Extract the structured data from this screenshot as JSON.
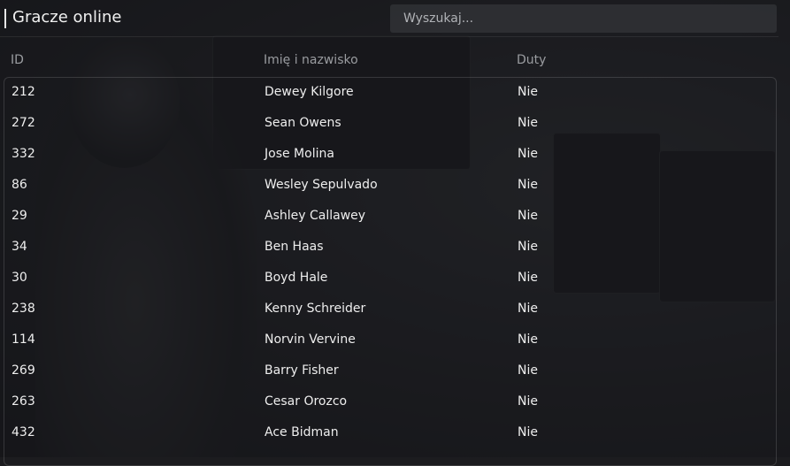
{
  "header": {
    "title": "Gracze online",
    "search_placeholder": "Wyszukaj..."
  },
  "columns": [
    "ID",
    "Imię i nazwisko",
    "Duty"
  ],
  "players": [
    {
      "id": "212",
      "name": "Dewey Kilgore",
      "duty": "Nie"
    },
    {
      "id": "272",
      "name": "Sean Owens",
      "duty": "Nie"
    },
    {
      "id": "332",
      "name": "Jose Molina",
      "duty": "Nie"
    },
    {
      "id": "86",
      "name": "Wesley Sepulvado",
      "duty": "Nie"
    },
    {
      "id": "29",
      "name": "Ashley Callawey",
      "duty": "Nie"
    },
    {
      "id": "34",
      "name": "Ben Haas",
      "duty": "Nie"
    },
    {
      "id": "30",
      "name": "Boyd Hale",
      "duty": "Nie"
    },
    {
      "id": "238",
      "name": "Kenny Schreider",
      "duty": "Nie"
    },
    {
      "id": "114",
      "name": "Norvin Vervine",
      "duty": "Nie"
    },
    {
      "id": "269",
      "name": "Barry Fisher",
      "duty": "Nie"
    },
    {
      "id": "263",
      "name": "Cesar Orozco",
      "duty": "Nie"
    },
    {
      "id": "432",
      "name": "Ace Bidman",
      "duty": "Nie"
    }
  ]
}
